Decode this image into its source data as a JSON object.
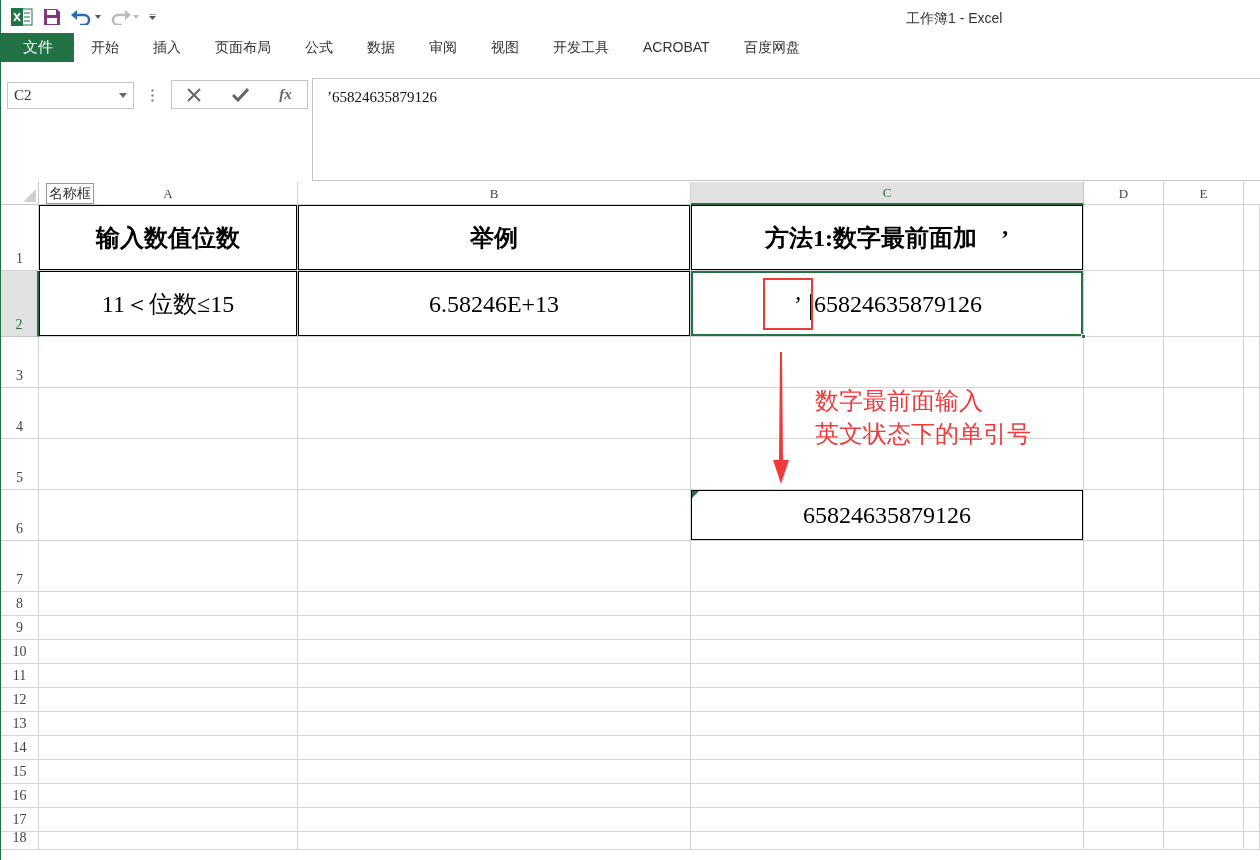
{
  "window": {
    "title": "工作簿1 - Excel"
  },
  "ribbon_tabs": [
    {
      "label": "文件",
      "kind": "file"
    },
    {
      "label": "开始",
      "kind": "tab"
    },
    {
      "label": "插入",
      "kind": "tab"
    },
    {
      "label": "页面布局",
      "kind": "tab"
    },
    {
      "label": "公式",
      "kind": "tab"
    },
    {
      "label": "数据",
      "kind": "tab"
    },
    {
      "label": "审阅",
      "kind": "tab"
    },
    {
      "label": "视图",
      "kind": "tab"
    },
    {
      "label": "开发工具",
      "kind": "tab"
    },
    {
      "label": "ACROBAT",
      "kind": "tab"
    },
    {
      "label": "百度网盘",
      "kind": "tab"
    }
  ],
  "formula_bar": {
    "name_box": "C2",
    "function_button": "fx",
    "content": "’65824635879126",
    "tooltip": "名称框"
  },
  "sheet": {
    "columns": [
      {
        "label": "A",
        "selected": false
      },
      {
        "label": "B",
        "selected": false
      },
      {
        "label": "C",
        "selected": true
      },
      {
        "label": "D",
        "selected": false
      },
      {
        "label": "E",
        "selected": false
      }
    ],
    "rows": [
      {
        "header": "1",
        "selected": false,
        "cells": [
          {
            "text": "输入数值位数",
            "bold": true,
            "bordered": true
          },
          {
            "text": "举例",
            "bold": true,
            "bordered": true
          },
          {
            "text": "方法1:数字最前面加　’",
            "bold": true,
            "bordered": true
          }
        ]
      },
      {
        "header": "2",
        "selected": true,
        "cells": [
          {
            "text": "11＜位数≤15",
            "bold": false,
            "bordered": true
          },
          {
            "text": "6.58246E+13",
            "bold": false,
            "bordered": true
          },
          {
            "prefix": "’",
            "text": "65824635879126",
            "bold": false,
            "bordered": true,
            "active": true,
            "highlight_prefix": true
          }
        ]
      },
      {
        "header": "3",
        "selected": false
      },
      {
        "header": "4",
        "selected": false
      },
      {
        "header": "5",
        "selected": false
      },
      {
        "header": "6",
        "selected": false,
        "cells": [
          null,
          null,
          {
            "text": "65824635879126",
            "bold": false,
            "bordered": true,
            "number_as_text_flag": true
          }
        ]
      },
      {
        "header": "7",
        "selected": false
      },
      {
        "header": "8",
        "selected": false
      },
      {
        "header": "9",
        "selected": false
      },
      {
        "header": "10",
        "selected": false
      },
      {
        "header": "11",
        "selected": false
      },
      {
        "header": "12",
        "selected": false
      },
      {
        "header": "13",
        "selected": false
      },
      {
        "header": "14",
        "selected": false
      },
      {
        "header": "15",
        "selected": false
      },
      {
        "header": "16",
        "selected": false
      },
      {
        "header": "17",
        "selected": false
      },
      {
        "header": "18",
        "selected": false
      }
    ]
  },
  "annotation": {
    "lines": [
      "数字最前面输入",
      "英文状态下的单引号"
    ]
  }
}
